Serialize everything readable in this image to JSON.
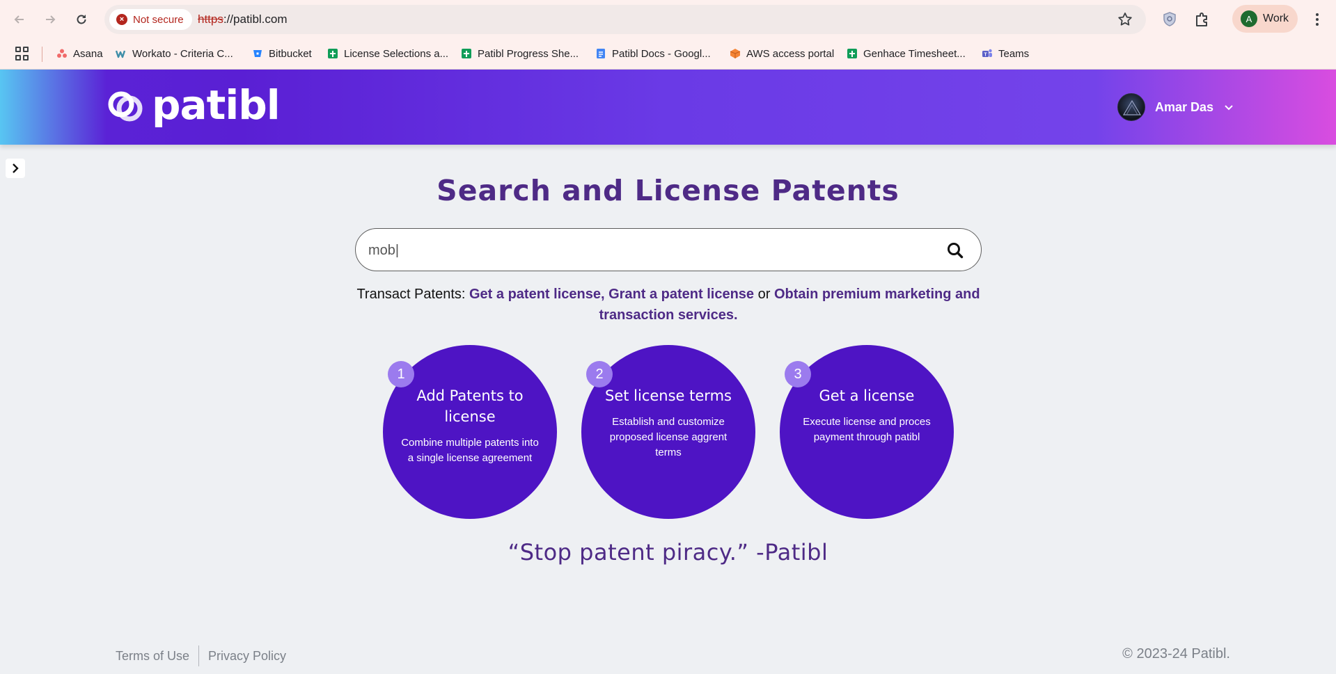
{
  "browser": {
    "security_label": "Not secure",
    "url_scheme": "https",
    "url_rest": "://patibl.com",
    "profile_initial": "A",
    "profile_label": "Work"
  },
  "bookmarks": [
    {
      "label": "Asana",
      "icon": "asana-icon",
      "color": "#f06a6a"
    },
    {
      "label": "Workato - Criteria C...",
      "icon": "workato-icon",
      "color": "#3e8ea8"
    },
    {
      "label": "Bitbucket",
      "icon": "bitbucket-icon",
      "color": "#2684ff"
    },
    {
      "label": "License Selections a...",
      "icon": "sheets-icon",
      "color": "#0f9d58"
    },
    {
      "label": "Patibl Progress She...",
      "icon": "sheets-icon",
      "color": "#0f9d58"
    },
    {
      "label": "Patibl Docs - Googl...",
      "icon": "docs-icon",
      "color": "#4285f4"
    },
    {
      "label": "AWS access portal",
      "icon": "aws-icon",
      "color": "#f58536"
    },
    {
      "label": "Genhace Timesheet...",
      "icon": "sheets-icon",
      "color": "#0f9d58"
    },
    {
      "label": "Teams",
      "icon": "teams-icon",
      "color": "#5b5fc7"
    }
  ],
  "header": {
    "logo_text": "patibl",
    "user_name": "Amar Das"
  },
  "main": {
    "title": "Search and License Patents",
    "search_value": "mob|",
    "transact_prefix": "Transact Patents: ",
    "link_get": "Get a patent license,",
    "link_grant": "Grant a patent license",
    "or_text": " or ",
    "link_premium": "Obtain premium marketing and transaction services.",
    "steps": [
      {
        "number": "1",
        "title": "Add Patents to license",
        "desc": "Combine multiple patents into a single license agreement"
      },
      {
        "number": "2",
        "title": "Set license terms",
        "desc": "Establish and customize proposed license aggrent terms"
      },
      {
        "number": "3",
        "title": "Get a license",
        "desc": "Execute license and proces payment through patibl"
      }
    ],
    "quote": "“Stop patent piracy.” -Patibl"
  },
  "footer": {
    "terms": "Terms of Use",
    "privacy": "Privacy Policy",
    "copyright": "© 2023-24 Patibl."
  },
  "colors": {
    "brand_purple": "#4e14c4",
    "title_purple": "#4e2a86",
    "step_number_bg": "#9b7bee"
  }
}
